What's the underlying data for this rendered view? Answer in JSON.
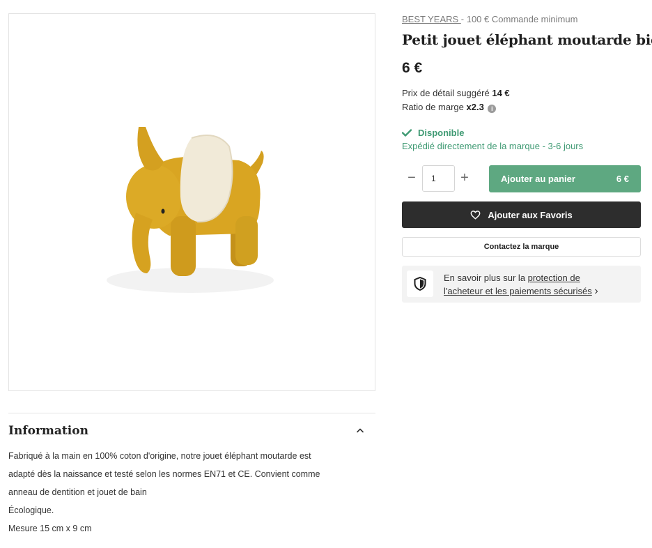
{
  "brand": {
    "name": "BEST YEARS ",
    "minimum_order": " - 100 € Commande minimum"
  },
  "product": {
    "title": "Petit jouet éléphant moutarde bio",
    "price": "6 €",
    "image_alt": "elephant-toy-photo"
  },
  "pricing": {
    "retail_label": "Prix de détail suggéré ",
    "retail_value": "14 €",
    "margin_label": "Ratio de marge ",
    "margin_value": "x2.3",
    "info_glyph": "i"
  },
  "availability": {
    "status": "Disponible",
    "shipping": "Expédié directement de la marque - 3-6 jours"
  },
  "purchase": {
    "quantity": "1",
    "minus_glyph": "−",
    "plus_glyph": "+",
    "add_to_cart_label": "Ajouter au panier",
    "add_to_cart_price": "6 €",
    "favorites_label": "Ajouter aux Favoris",
    "contact_label": "Contactez la marque"
  },
  "protection": {
    "prefix": "En savoir plus sur la ",
    "link_line1": "protection de",
    "link_line2": "l'acheteur et les paiements sécurisés",
    "chevron": "›"
  },
  "information": {
    "heading": "Information",
    "lines": [
      "Fabriqué à la main en 100% coton d'origine, notre jouet éléphant moutarde est",
      "adapté dès la naissance et testé selon les normes EN71 et CE. Convient comme",
      "anneau de dentition et jouet de bain",
      "Écologique.",
      "Mesure 15 cm x 9 cm"
    ]
  },
  "colors": {
    "accent_green": "#5ea881",
    "status_green": "#3f9a73",
    "dark_button": "#2d2d2d",
    "toy_mustard": "#d9a320"
  }
}
